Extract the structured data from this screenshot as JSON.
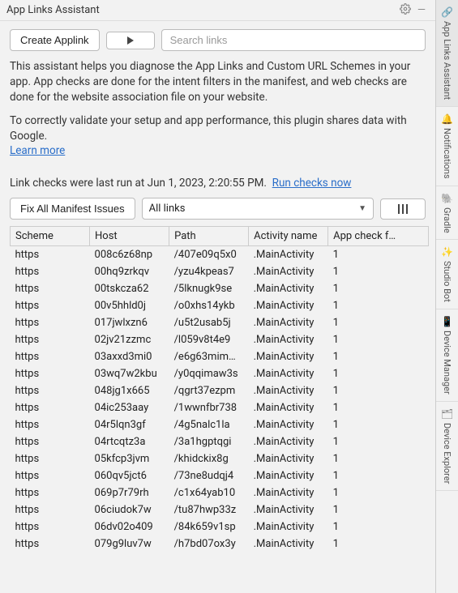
{
  "titleBar": {
    "title": "App Links Assistant"
  },
  "toolbar": {
    "createButton": "Create Applink",
    "searchPlaceholder": "Search links"
  },
  "description": {
    "p1": "This assistant helps you diagnose the App Links and Custom URL Schemes in your app. App checks are done for the intent filters in the manifest, and web checks are done for the website association file on your website.",
    "p2": "To correctly validate your setup and app performance, this plugin shares data with Google.",
    "learnMore": "Learn more"
  },
  "status": {
    "lastRun": "Link checks were last run at Jun 1, 2023, 2:20:55 PM.",
    "runNow": "Run checks now"
  },
  "controls": {
    "fixButton": "Fix All Manifest Issues",
    "filterSelected": "All links"
  },
  "table": {
    "headers": {
      "scheme": "Scheme",
      "host": "Host",
      "path": "Path",
      "activity": "Activity name",
      "appcheck": "App check f…"
    },
    "rows": [
      {
        "scheme": "https",
        "host": "008c6z68np",
        "path": "/407e09q5x0",
        "activity": ".MainActivity",
        "appcheck": "1"
      },
      {
        "scheme": "https",
        "host": "00hq9zrkqv",
        "path": "/yzu4kpeas7",
        "activity": ".MainActivity",
        "appcheck": "1"
      },
      {
        "scheme": "https",
        "host": "00tskcza62",
        "path": "/5lknugk9se",
        "activity": ".MainActivity",
        "appcheck": "1"
      },
      {
        "scheme": "https",
        "host": "00v5hhld0j",
        "path": "/o0xhs14ykb",
        "activity": ".MainActivity",
        "appcheck": "1"
      },
      {
        "scheme": "https",
        "host": "017jwlxzn6",
        "path": "/u5t2usab5j",
        "activity": ".MainActivity",
        "appcheck": "1"
      },
      {
        "scheme": "https",
        "host": "02jv21zzmc",
        "path": "/l059v8t4e9",
        "activity": ".MainActivity",
        "appcheck": "1"
      },
      {
        "scheme": "https",
        "host": "03axxd3mi0",
        "path": "/e6g63mim…",
        "activity": ".MainActivity",
        "appcheck": "1"
      },
      {
        "scheme": "https",
        "host": "03wq7w2kbu",
        "path": "/y0qqimaw3s",
        "activity": ".MainActivity",
        "appcheck": "1"
      },
      {
        "scheme": "https",
        "host": "048jg1x665",
        "path": "/qgrt37ezpm",
        "activity": ".MainActivity",
        "appcheck": "1"
      },
      {
        "scheme": "https",
        "host": "04ic253aay",
        "path": "/1wwnfbr738",
        "activity": ".MainActivity",
        "appcheck": "1"
      },
      {
        "scheme": "https",
        "host": "04r5lqn3gf",
        "path": "/4g5nalc1la",
        "activity": ".MainActivity",
        "appcheck": "1"
      },
      {
        "scheme": "https",
        "host": "04rtcqtz3a",
        "path": "/3a1hgptqgi",
        "activity": ".MainActivity",
        "appcheck": "1"
      },
      {
        "scheme": "https",
        "host": "05kfcp3jvm",
        "path": "/khidckix8g",
        "activity": ".MainActivity",
        "appcheck": "1"
      },
      {
        "scheme": "https",
        "host": "060qv5jct6",
        "path": "/73ne8udqj4",
        "activity": ".MainActivity",
        "appcheck": "1"
      },
      {
        "scheme": "https",
        "host": "069p7r79rh",
        "path": "/c1x64yab10",
        "activity": ".MainActivity",
        "appcheck": "1"
      },
      {
        "scheme": "https",
        "host": "06ciudok7w",
        "path": "/tu87hwp33z",
        "activity": ".MainActivity",
        "appcheck": "1"
      },
      {
        "scheme": "https",
        "host": "06dv02o409",
        "path": "/84k659v1sp",
        "activity": ".MainActivity",
        "appcheck": "1"
      },
      {
        "scheme": "https",
        "host": "079g9luv7w",
        "path": "/h7bd07ox3y",
        "activity": ".MainActivity",
        "appcheck": "1"
      }
    ]
  },
  "sideRail": {
    "items": [
      {
        "label": "App Links Assistant",
        "icon": "🔗",
        "active": true
      },
      {
        "label": "Notifications",
        "icon": "🔔",
        "active": false
      },
      {
        "label": "Gradle",
        "icon": "🐘",
        "active": false
      },
      {
        "label": "Studio Bot",
        "icon": "✨",
        "active": false
      },
      {
        "label": "Device Manager",
        "icon": "📱",
        "active": false
      },
      {
        "label": "Device Explorer",
        "icon": "🗂",
        "active": false
      }
    ]
  }
}
